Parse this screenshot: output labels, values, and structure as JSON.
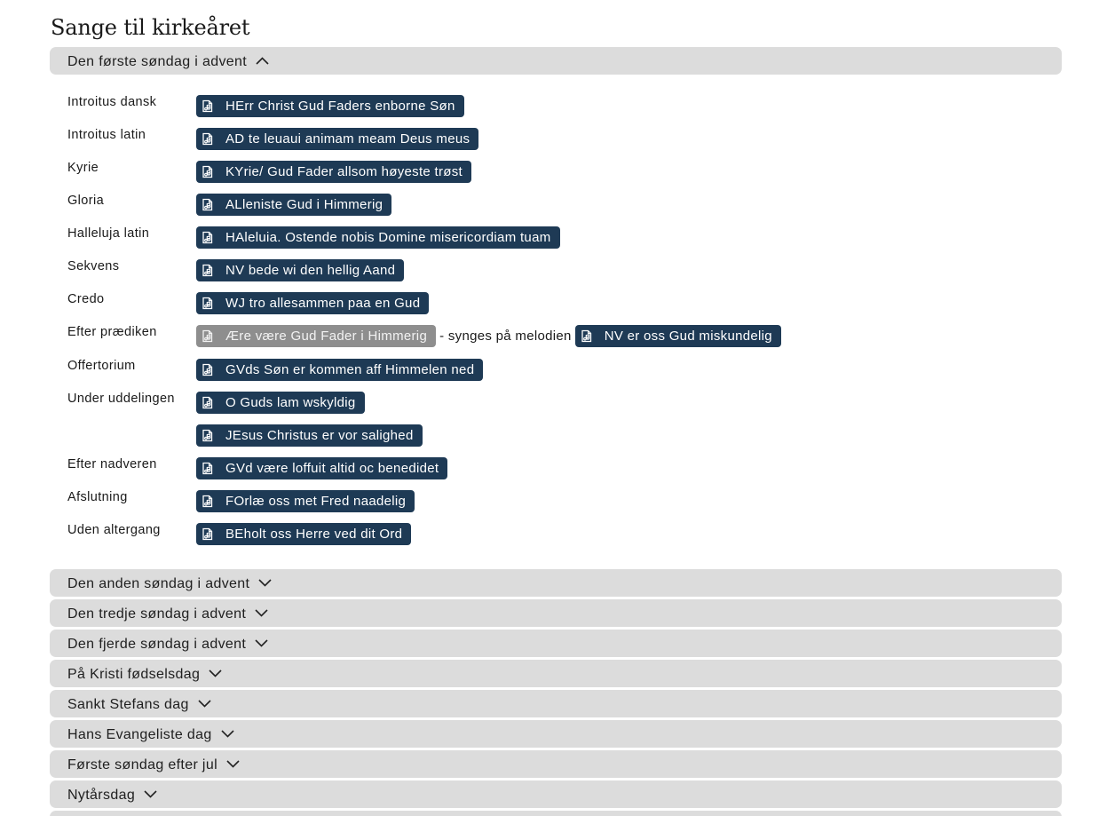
{
  "page": {
    "title": "Sange til kirkeåret"
  },
  "open_section": {
    "title": "Den første søndag i advent",
    "rows": [
      {
        "label": "Introitus dansk",
        "song": "HErr Christ Gud Faders enborne Søn"
      },
      {
        "label": "Introitus latin",
        "song": "AD te leuaui animam meam Deus meus"
      },
      {
        "label": "Kyrie",
        "song": "KYrie/ Gud Fader allsom høyeste trøst"
      },
      {
        "label": "Gloria",
        "song": "ALleniste Gud i Himmerig"
      },
      {
        "label": "Halleluja latin",
        "song": "HAleluia. Ostende nobis Domine misericordiam tuam"
      },
      {
        "label": "Sekvens",
        "song": "NV bede wi den hellig Aand"
      },
      {
        "label": "Credo",
        "song": "WJ tro allesammen paa en Gud"
      },
      {
        "label": "Efter prædiken",
        "song": "Ære være Gud Fader i Himmerig",
        "connector": "- synges på melodien",
        "melody": "NV er oss Gud miskundelig"
      },
      {
        "label": "Offertorium",
        "song": "GVds Søn er kommen aff Himmelen ned"
      },
      {
        "label": "Under uddelingen",
        "song": "O Guds lam wskyldig"
      },
      {
        "label": "",
        "song": "JEsus Christus er vor salighed"
      },
      {
        "label": "Efter nadveren",
        "song": "GVd være loffuit altid oc benedidet"
      },
      {
        "label": "Afslutning",
        "song": "FOrlæ oss met Fred naadelig"
      },
      {
        "label": "Uden altergang",
        "song": "BEholt oss Herre ved dit Ord"
      }
    ]
  },
  "collapsed_sections": [
    "Den anden søndag i advent",
    "Den tredje søndag i advent",
    "Den fjerde søndag i advent",
    "På Kristi fødselsdag",
    "Sankt Stefans dag",
    "Hans Evangeliste dag",
    "Første søndag efter jul",
    "Nytårsdag"
  ],
  "icons": {
    "song_chip": "music-note-file-icon",
    "expanded": "chevron-up-icon",
    "collapsed": "chevron-down-icon"
  },
  "colors": {
    "chip_bg": "#1e3a55",
    "chip_muted_bg": "#8e8e8e",
    "section_header_bg": "#dcdcdc"
  }
}
